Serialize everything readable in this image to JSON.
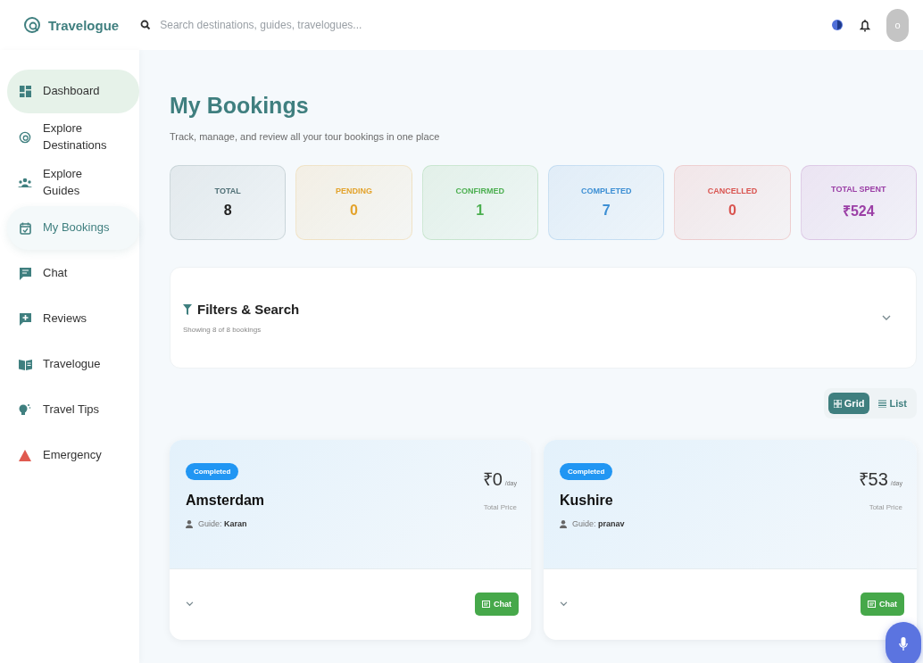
{
  "header": {
    "brand": "Travelogue",
    "search": {
      "placeholder": "Search destinations, guides, travelogues..."
    },
    "avatar": "o"
  },
  "sidebar": {
    "items": [
      {
        "label": "Dashboard",
        "selected": false,
        "highlighted": true
      },
      {
        "label": "Explore Destinations",
        "selected": false,
        "highlighted": false
      },
      {
        "label": "Explore Guides",
        "selected": false,
        "highlighted": false
      },
      {
        "label": "My Bookings",
        "selected": true,
        "highlighted": false
      },
      {
        "label": "Chat",
        "selected": false,
        "highlighted": false
      },
      {
        "label": "Reviews",
        "selected": false,
        "highlighted": false
      },
      {
        "label": "Travelogue",
        "selected": false,
        "highlighted": false
      },
      {
        "label": "Travel Tips",
        "selected": false,
        "highlighted": false
      },
      {
        "label": "Emergency",
        "selected": false,
        "highlighted": false
      }
    ]
  },
  "page": {
    "title": "My Bookings",
    "subtitle": "Track, manage, and review all your tour bookings in one place"
  },
  "stats": [
    {
      "label": "TOTAL",
      "value": "8",
      "color": "#4f6f75"
    },
    {
      "label": "PENDING",
      "value": "0",
      "color": "#e3a32c"
    },
    {
      "label": "CONFIRMED",
      "value": "1",
      "color": "#4caf50"
    },
    {
      "label": "COMPLETED",
      "value": "7",
      "color": "#3d8fd4"
    },
    {
      "label": "CANCELLED",
      "value": "0",
      "color": "#d9534f"
    },
    {
      "label": "TOTAL SPENT",
      "value": "₹524",
      "color": "#9b3fa6"
    }
  ],
  "filters": {
    "title": "Filters & Search",
    "summary": "Showing 8 of 8 bookings",
    "expanded": false
  },
  "view_toggle": [
    {
      "label": "Grid",
      "selected": true
    },
    {
      "label": "List",
      "selected": false
    }
  ],
  "bookings": [
    {
      "status": "Completed",
      "price": "₹0",
      "unit": "/day",
      "price_label": "Total Price",
      "destination": "Amsterdam",
      "guide": "Guide: **Karan**",
      "action": "Chat"
    },
    {
      "status": "Completed",
      "price": "₹53",
      "unit": "/day",
      "price_label": "Total Price",
      "destination": "Kushire",
      "guide": "Guide: **pranav**",
      "action": "Chat"
    }
  ]
}
